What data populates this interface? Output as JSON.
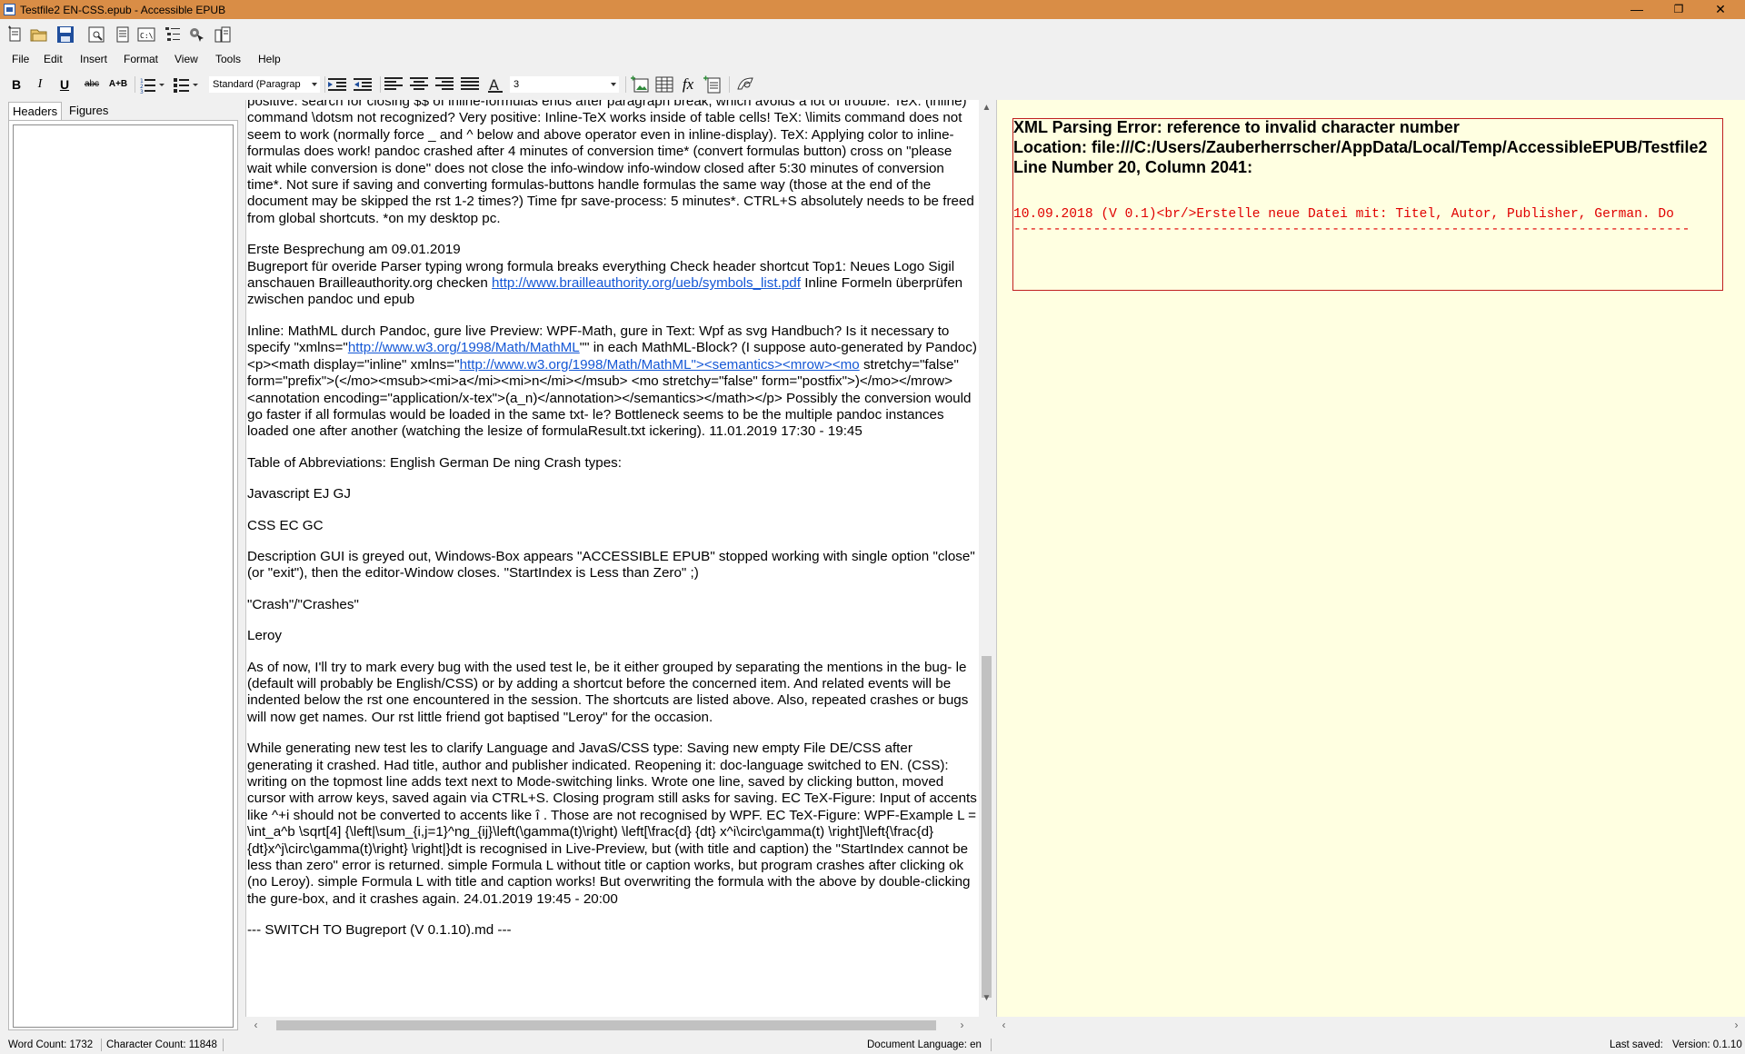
{
  "window": {
    "title": "Testfile2 EN-CSS.epub - Accessible EPUB",
    "controls": [
      "—",
      "❐",
      "✕"
    ]
  },
  "menu": [
    "File",
    "Edit",
    "Insert",
    "Format",
    "View",
    "Tools",
    "Help"
  ],
  "format_toolbar": {
    "bold": "B",
    "italic": "I",
    "underline": "U",
    "strike": "abc",
    "replace": "A+B",
    "paragraph_style": "Standard (Paragrap",
    "font_size": "3",
    "formula": "fx"
  },
  "sidebar": {
    "tabs": [
      "Headers",
      "Figures"
    ]
  },
  "editor": {
    "paragraphs": [
      "positive: search for closing $$ of inline-formulas ends after paragraph break, which avoids a lot of trouble. TeX: (inline) command \\dotsm not recognized? Very positive: Inline-TeX works inside of table cells! TeX: \\limits command does not seem to work (normally force _ and ^ below and above operator even in inline-display). TeX: Applying color to inline-formulas does work! pandoc crashed after 4 minutes of conversion time* (convert formulas button) cross on \"please wait while conversion is done\" does not close the info-window info-window closed after 5:30 minutes of conversion time*. Not sure if saving and converting formulas-buttons handle formulas the same way (those at the end of the document may be skipped the rst 1-2 times?) Time fpr save-process: 5 minutes*. CTRL+S absolutely needs to be freed from global shortcuts. *on my desktop pc.",
      "Erste Besprechung am 09.01.2019",
      "Table of Abbreviations: English German   De ning Crash types:",
      "Javascript EJ GJ",
      "CSS EC GC",
      "Description GUI is greyed out, Windows-Box appears \"ACCESSIBLE EPUB\" stopped working with single option \"close\" (or \"exit\"), then the editor-Window closes. \"StartIndex is Less than Zero\" ;)",
      "\"Crash\"/\"Crashes\"",
      "Leroy",
      "As of now, I'll try to mark every bug with the used test le, be it either grouped by separating the mentions in the bug- le (default will probably be English/CSS) or by adding a shortcut before the concerned item. And related events will be indented below the rst one encountered in the session. The shortcuts are listed above. Also, repeated crashes or bugs will now get names. Our rst little friend got baptised \"Leroy\" for the occasion.",
      " While generating new test les to clarify Language and JavaS/CSS type: Saving new empty File DE/CSS after generating it crashed. Had title, author and publisher indicated. Reopening it: doc-language switched to EN. (CSS): writing on the topmost line adds text next to Mode-switching links. Wrote one line, saved by clicking button, moved cursor with arrow keys, saved again via CTRL+S. Closing program still asks for saving. EC TeX-Figure: Input of accents like ^+i should not be converted to accents like î . Those are not recognised by WPF. EC TeX-Figure: WPF-Example L = \\int_a^b \\sqrt[4] {\\left|\\sum_{i,j=1}^ng_{ij}\\left(\\gamma(t)\\right) \\left[\\frac{d} {dt} x^i\\circ\\gamma(t) \\right]\\left{\\frac{d} {dt}x^j\\circ\\gamma(t)\\right} \\right|}dt is recognised in Live-Preview, but (with title and caption) the \"StartIndex cannot be less than zero\" error is returned. simple Formula L without title or caption works, but program crashes after clicking ok (no Leroy). simple Formula L with title and caption works! But overwriting the formula with the above by double-clicking the gure-box, and it crashes again.   24.01.2019 19:45 - 20:00",
      "--- SWITCH TO Bugreport (V 0.1.10).md ---"
    ],
    "bugreport": {
      "text": "  Bugreport für overide Parser typing wrong formula breaks everything Check header shortcut Top1: Neues Logo Sigil anschauen Brailleauthority.org checken ",
      "link": "http://www.brailleauthority.org/ueb/symbols_list.pdf",
      "after": " Inline Formeln überprüfen zwischen pandoc und epub"
    },
    "mathml": {
      "text1": " Inline: MathML durch Pandoc, gure live Preview: WPF-Math, gure in Text: Wpf as svg Handbuch?   Is it necessary to specify \"xmlns=\"",
      "link1": "http://www.w3.org/1998/Math/MathML",
      "text2": "\"\" in each MathML-Block? (I suppose auto-generated by Pandoc) <p><math display=\"inline\" xmlns=\"",
      "link2": "http://www.w3.org/1998/Math/MathML\"><semantics><mrow><mo",
      "text3": " stretchy=\"false\" form=\"prefix\">(</mo><msub><mi>a</mi><mi>n</mi></msub> <mo stretchy=\"false\" form=\"postfix\">)</mo></mrow><annotation encoding=\"application/x-tex\">(a_n)</annotation></semantics></math></p> Possibly the conversion would go faster if all formulas would be loaded in the same txt- le? Bottleneck seems to be the multiple pandoc instances loaded one after another (watching the lesize of formulaResult.txt ickering). 11.01.2019 17:30 - 19:45"
    }
  },
  "preview": {
    "error_line1": "XML Parsing Error: reference to invalid character number",
    "error_line2": "Location: file:///C:/Users/Zauberherrscher/AppData/Local/Temp/AccessibleEPUB/Testfile2",
    "error_line3": "Line Number 20, Column 2041:",
    "source_line": "10.09.2018 (V 0.1)<br/>Erstelle neue Datei mit: Titel, Autor, Publisher, German. Do",
    "pointer_line": "-------------------------------------------------------------------------------------"
  },
  "status": {
    "word_count": "Word Count: 1732",
    "char_count": "Character Count: 11848",
    "language": "Document Language: en",
    "last_saved": "Last saved:",
    "version": "Version: 0.1.10"
  }
}
